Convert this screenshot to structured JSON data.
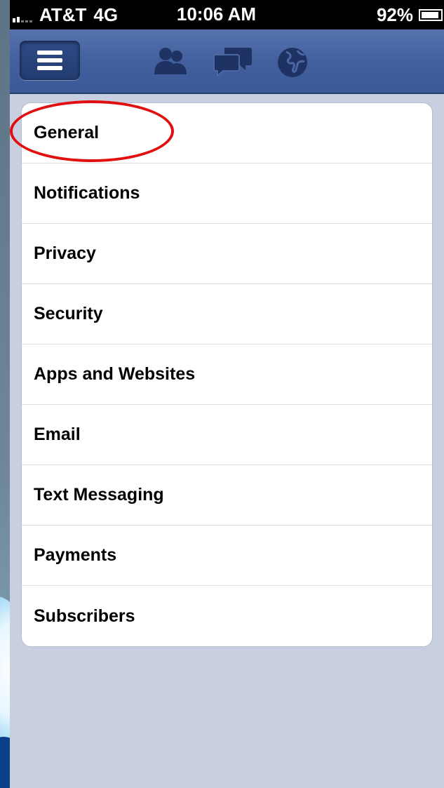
{
  "status_bar": {
    "carrier": "AT&T",
    "network": "4G",
    "time": "10:06 AM",
    "battery_percent": "92%",
    "battery_level": 0.92
  },
  "nav_bar": {
    "icons": [
      "menu-icon",
      "friends-icon",
      "messages-icon",
      "notifications-globe-icon"
    ],
    "colors": {
      "background": "#3b5998",
      "button": "#233c70"
    }
  },
  "settings": {
    "items": [
      {
        "label": "General"
      },
      {
        "label": "Notifications"
      },
      {
        "label": "Privacy"
      },
      {
        "label": "Security"
      },
      {
        "label": "Apps and Websites"
      },
      {
        "label": "Email"
      },
      {
        "label": "Text Messaging"
      },
      {
        "label": "Payments"
      },
      {
        "label": "Subscribers"
      }
    ]
  },
  "annotation": {
    "highlight_color": "#e01010",
    "highlighted_item": "General"
  }
}
